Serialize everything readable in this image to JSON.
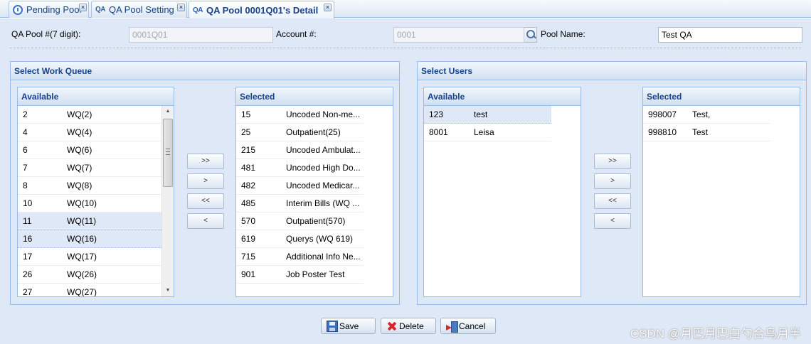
{
  "tabs": [
    {
      "label": "Pending Pool",
      "icon": "clock-icon",
      "close": "×"
    },
    {
      "label": "QA Pool Setting",
      "icon": "QA",
      "close": "×"
    },
    {
      "label": "QA Pool 0001Q01's Detail",
      "icon": "QA",
      "close": "×"
    }
  ],
  "form": {
    "pool_label": "QA Pool #(7 digit):",
    "pool_value": "0001Q01",
    "account_label": "Account #:",
    "account_value": "0001",
    "pool_name_label": "Pool Name:",
    "pool_name_value": "Test QA"
  },
  "work_queue": {
    "title": "Select Work Queue",
    "available_header": "Available",
    "selected_header": "Selected",
    "available": [
      {
        "id": "2",
        "name": "WQ(2)"
      },
      {
        "id": "4",
        "name": "WQ(4)"
      },
      {
        "id": "6",
        "name": "WQ(6)"
      },
      {
        "id": "7",
        "name": "WQ(7)"
      },
      {
        "id": "8",
        "name": "WQ(8)"
      },
      {
        "id": "10",
        "name": "WQ(10)"
      },
      {
        "id": "11",
        "name": "WQ(11)",
        "selected": true
      },
      {
        "id": "16",
        "name": "WQ(16)",
        "selected": true
      },
      {
        "id": "17",
        "name": "WQ(17)"
      },
      {
        "id": "26",
        "name": "WQ(26)"
      },
      {
        "id": "27",
        "name": "WQ(27)"
      }
    ],
    "selected": [
      {
        "id": "15",
        "name": "Uncoded Non-me..."
      },
      {
        "id": "25",
        "name": "Outpatient(25)"
      },
      {
        "id": "215",
        "name": "Uncoded Ambulat..."
      },
      {
        "id": "481",
        "name": "Uncoded High Do..."
      },
      {
        "id": "482",
        "name": "Uncoded Medicar..."
      },
      {
        "id": "485",
        "name": "Interim Bills (WQ ..."
      },
      {
        "id": "570",
        "name": "Outpatient(570)"
      },
      {
        "id": "619",
        "name": "Querys (WQ 619)"
      },
      {
        "id": "715",
        "name": "Additional Info Ne..."
      },
      {
        "id": "901",
        "name": "Job Poster Test"
      }
    ],
    "buttons": [
      ">>",
      ">",
      "<<",
      "<"
    ]
  },
  "users": {
    "title": "Select Users",
    "available_header": "Available",
    "selected_header": "Selected",
    "available": [
      {
        "id": "123",
        "name": "test",
        "selected": true
      },
      {
        "id": "8001",
        "name": "Leisa"
      }
    ],
    "selected": [
      {
        "id": "998007",
        "name": "Test,"
      },
      {
        "id": "998810",
        "name": "Test"
      }
    ],
    "buttons": [
      ">>",
      ">",
      "<<",
      "<"
    ]
  },
  "footer": {
    "save": "Save",
    "delete": "Delete",
    "cancel": "Cancel"
  },
  "watermark": "CSDN @月巴月巴白勺合鸟月半"
}
